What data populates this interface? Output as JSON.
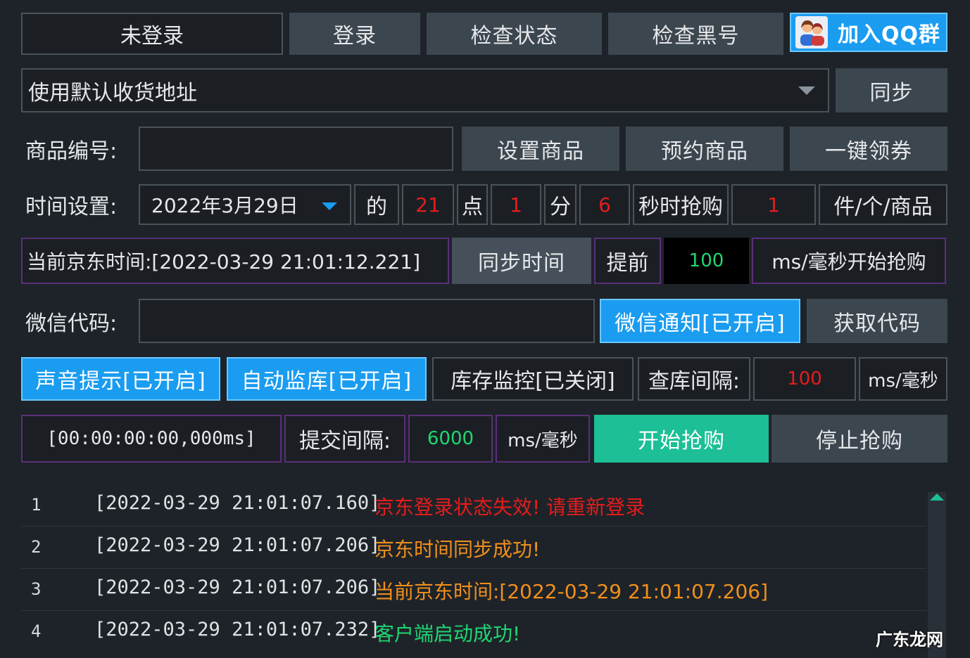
{
  "header": {
    "login_status": "未登录",
    "login_button": "登录",
    "check_status_button": "检查状态",
    "check_blacklist_button": "检查黑号",
    "join_qq_button": "加入QQ群"
  },
  "address": {
    "selected": "使用默认收货地址",
    "sync_button": "同步"
  },
  "product": {
    "label": "商品编号:",
    "value": "",
    "set_button": "设置商品",
    "reserve_button": "预约商品",
    "coupon_button": "一键领券"
  },
  "time_setting": {
    "label": "时间设置:",
    "date": "2022年3月29日",
    "of_label": "的",
    "hour": "21",
    "hour_label": "点",
    "minute": "1",
    "minute_label": "分",
    "second": "6",
    "second_label": "秒时抢购",
    "quantity": "1",
    "quantity_unit": "件/个/商品"
  },
  "jd_time": {
    "current": "当前京东时间:[2022-03-29 21:01:12.221]",
    "sync_button": "同步时间",
    "advance_label": "提前",
    "advance_value": "100",
    "advance_unit": "ms/毫秒开始抢购"
  },
  "wechat": {
    "label": "微信代码:",
    "value": "",
    "notify_button": "微信通知[已开启]",
    "get_code_button": "获取代码"
  },
  "toggles": {
    "sound": "声音提示[已开启]",
    "auto_monitor": "自动监库[已开启]",
    "stock_monitor": "库存监控[已关闭]",
    "check_interval_label": "查库间隔:",
    "check_interval_value": "100",
    "check_interval_unit": "ms/毫秒"
  },
  "run": {
    "timer": "[00:00:00:00,000ms]",
    "submit_interval_label": "提交间隔:",
    "submit_interval_value": "6000",
    "submit_interval_unit": "ms/毫秒",
    "start_button": "开始抢购",
    "stop_button": "停止抢购"
  },
  "log": [
    {
      "n": "1",
      "time": "[2022-03-29 21:01:07.160]",
      "msg": "京东登录状态失效! 请重新登录",
      "color": "#e51c1c"
    },
    {
      "n": "2",
      "time": "[2022-03-29 21:01:07.206]",
      "msg": "京东时间同步成功!",
      "color": "#f0901c"
    },
    {
      "n": "3",
      "time": "[2022-03-29 21:01:07.206]",
      "msg": "当前京东时间:[2022-03-29 21:01:07.206]",
      "color": "#f0901c"
    },
    {
      "n": "4",
      "time": "[2022-03-29 21:01:07.232]",
      "msg": "客户端启动成功!",
      "color": "#1fd672"
    }
  ],
  "watermark": "广东龙网",
  "colors": {
    "accent_blue": "#1a9cf0",
    "start_green": "#1cbf96",
    "value_red": "#e51c1c",
    "value_green": "#1fd672"
  }
}
